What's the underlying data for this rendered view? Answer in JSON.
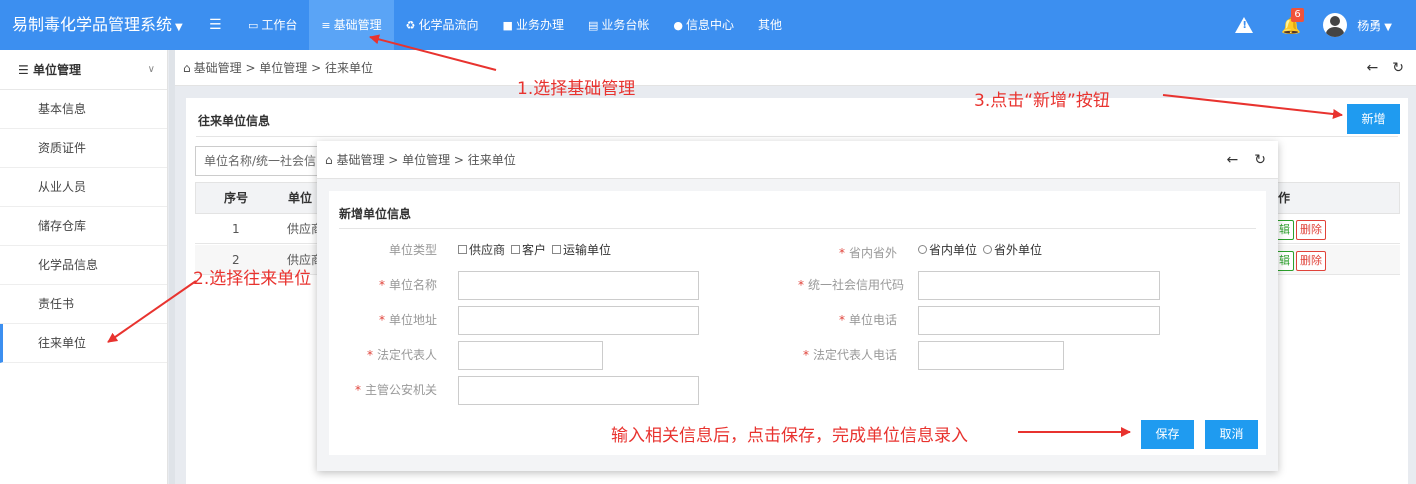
{
  "app": {
    "title": "易制毒化学品管理系统"
  },
  "nav": {
    "items": [
      {
        "label": "工作台",
        "icon": "monitor-icon"
      },
      {
        "label": "基础管理",
        "icon": "list-icon",
        "active": true
      },
      {
        "label": "化学品流向",
        "icon": "recycle-icon"
      },
      {
        "label": "业务办理",
        "icon": "briefcase-icon"
      },
      {
        "label": "业务台帐",
        "icon": "ledger-icon"
      },
      {
        "label": "信息中心",
        "icon": "info-icon"
      },
      {
        "label": "其他",
        "icon": ""
      }
    ]
  },
  "user": {
    "name": "杨勇",
    "notifications": "6"
  },
  "sidebar": {
    "header": "单位管理",
    "items": [
      {
        "label": "基本信息"
      },
      {
        "label": "资质证件"
      },
      {
        "label": "从业人员"
      },
      {
        "label": "储存仓库"
      },
      {
        "label": "化学品信息"
      },
      {
        "label": "责任书"
      },
      {
        "label": "往来单位",
        "active": true
      }
    ]
  },
  "breadcrumb": {
    "text": "基础管理 > 单位管理 > 往来单位"
  },
  "panel": {
    "title": "往来单位信息",
    "search_text": "单位名称/统一社会信",
    "add_label": "新增",
    "columns": [
      "序号",
      "单位",
      "作"
    ],
    "rows": [
      {
        "index": "1",
        "type": "供应商",
        "edit": "辑",
        "delete": "删除"
      },
      {
        "index": "2",
        "type": "供应商",
        "edit": "辑",
        "delete": "删除"
      }
    ]
  },
  "modal": {
    "breadcrumb": "基础管理 > 单位管理 > 往来单位",
    "title": "新增单位信息",
    "unit_type_label": "单位类型",
    "unit_type_options": [
      "供应商",
      "客户",
      "运输单位"
    ],
    "province_label": "省内省外",
    "province_options": [
      "省内单位",
      "省外单位"
    ],
    "fields": {
      "name": "单位名称",
      "credit_code": "统一社会信用代码",
      "address": "单位地址",
      "phone": "单位电话",
      "legal_rep": "法定代表人",
      "legal_rep_phone": "法定代表人电话",
      "police": "主管公安机关"
    },
    "save_label": "保存",
    "cancel_label": "取消"
  },
  "annotations": {
    "step1": "1.选择基础管理",
    "step2": "2.选择往来单位",
    "step3": "3.点击“新增”按钮",
    "step4": "输入相关信息后，点击保存，完成单位信息录入"
  },
  "colors": {
    "primary": "#3c8ff0",
    "button": "#1f9bf0",
    "annotation": "#e8332f"
  }
}
